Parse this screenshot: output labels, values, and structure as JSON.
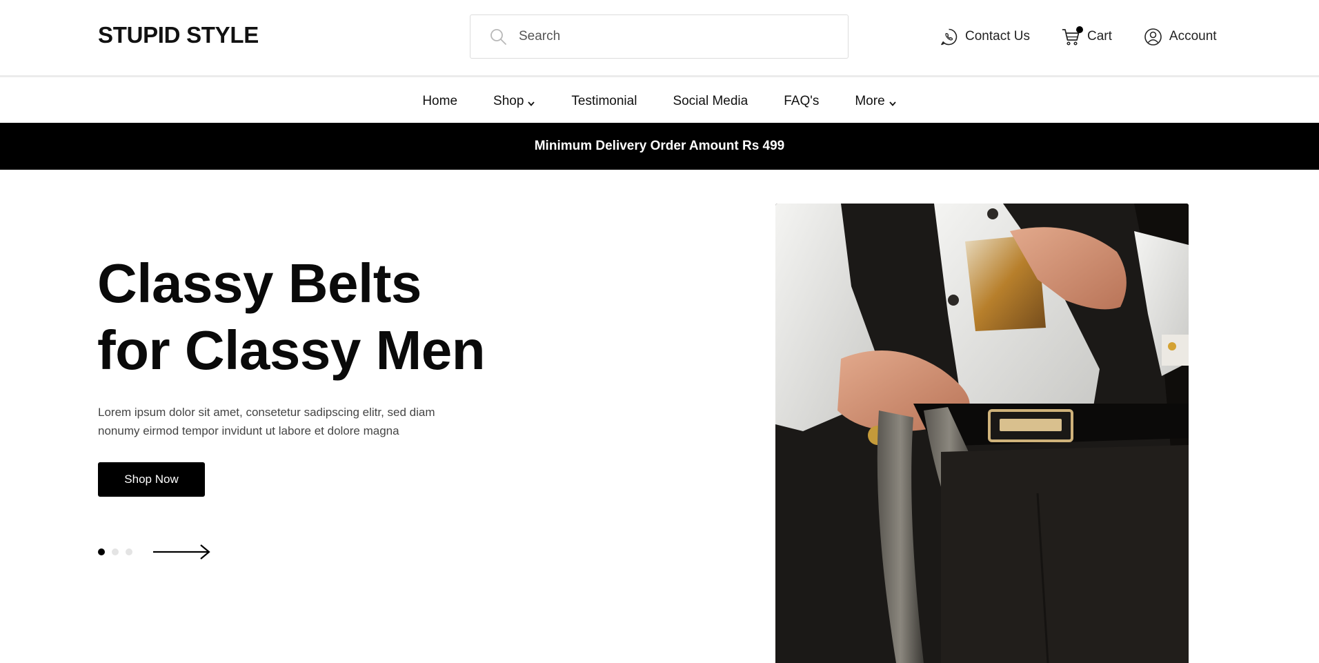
{
  "brand": {
    "name": "STUPID STYLE"
  },
  "search": {
    "placeholder": "Search"
  },
  "top_actions": {
    "contact_label": "Contact Us",
    "cart_label": "Cart",
    "account_label": "Account"
  },
  "nav": {
    "items": [
      {
        "label": "Home"
      },
      {
        "label": "Shop"
      },
      {
        "label": "Testimonial"
      },
      {
        "label": "Social Media"
      },
      {
        "label": "FAQ's"
      },
      {
        "label": "More"
      }
    ]
  },
  "announcement": {
    "text": "Minimum Delivery Order Amount Rs 499"
  },
  "hero": {
    "title_line1": "Classy Belts",
    "title_line2": "for Classy Men",
    "description": "Lorem ipsum dolor sit amet, consetetur sadipscing elitr, sed diam nonumy eirmod tempor invidunt ut labore et dolore magna",
    "cta_label": "Shop Now",
    "slides_total": 3,
    "active_slide": 1
  },
  "icons": {
    "search": "search-icon",
    "contact": "whatsapp-icon",
    "cart": "cart-icon",
    "account": "user-circle-icon",
    "dropdown": "chevron-down-icon",
    "next": "arrow-right-icon"
  },
  "colors": {
    "primary": "#000000",
    "background": "#ffffff",
    "inactive_dot": "#e4e4e4"
  }
}
